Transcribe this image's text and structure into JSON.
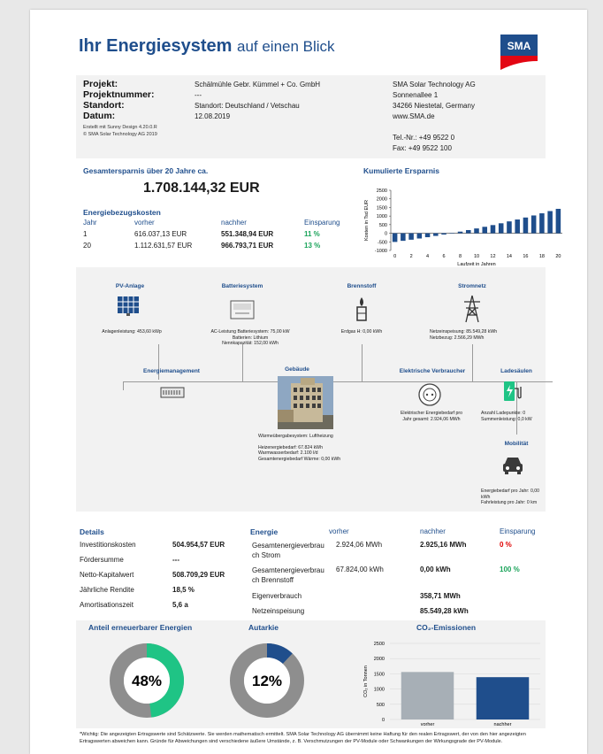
{
  "header": {
    "title_bold": "Ihr Energiesystem",
    "title_rest": "auf einen Blick",
    "logo": "SMA"
  },
  "project": {
    "labels": [
      "Projekt:",
      "Projektnummer:",
      "Standort:",
      "Datum:"
    ],
    "values": [
      "Schälmühle Gebr. Kümmel + Co. GmbH",
      "---",
      "Standort: Deutschland / Vetschau",
      "12.08.2019"
    ],
    "created_with": "Erstellt mit Sunny Design 4.20.0.R",
    "copyright": "© SMA Solar Technology AG 2019",
    "company_lines": [
      "SMA Solar Technology AG",
      "Sonnenallee 1",
      "34266 Niestetal, Germany",
      "www.SMA.de"
    ],
    "phone": "Tel.-Nr.: +49 9522 0",
    "fax": "Fax: +49 9522 100"
  },
  "savings": {
    "heading": "Gesamtersparnis über 20 Jahre ca.",
    "total": "1.708.144,32 EUR",
    "costs_heading": "Energiebezugskosten",
    "columns": [
      "Jahr",
      "vorher",
      "nachher",
      "Einsparung"
    ],
    "rows": [
      {
        "year": "1",
        "before": "616.037,13 EUR",
        "after": "551.348,94 EUR",
        "saving": "11 %"
      },
      {
        "year": "20",
        "before": "1.112.631,57 EUR",
        "after": "966.793,71 EUR",
        "saving": "13 %"
      }
    ]
  },
  "chart_data": [
    {
      "type": "bar",
      "title": "Kumulierte Ersparnis",
      "xlabel": "Laufzeit in Jahren",
      "ylabel": "Kosten in Tsd EUR",
      "ylim": [
        -1000,
        2500
      ],
      "yticks": [
        "2500",
        "2000",
        "1500",
        "1000",
        "500",
        "0",
        "-500",
        "-1000"
      ],
      "xticks": [
        "0",
        "2",
        "4",
        "6",
        "8",
        "10",
        "12",
        "14",
        "16",
        "18",
        "20"
      ],
      "categories": [
        0,
        1,
        2,
        3,
        4,
        5,
        6,
        7,
        8,
        9,
        10,
        11,
        12,
        13,
        14,
        15,
        16,
        17,
        18,
        19,
        20
      ],
      "values": [
        -505,
        -440,
        -375,
        -305,
        -230,
        -155,
        -75,
        10,
        95,
        185,
        280,
        375,
        475,
        580,
        690,
        800,
        915,
        1035,
        1160,
        1290,
        1420
      ],
      "color": "#1f4e8c"
    },
    {
      "type": "pie",
      "title": "Anteil erneuerbarer Energien",
      "value_percent": 48,
      "label": "48%",
      "color": "#1fc485"
    },
    {
      "type": "pie",
      "title": "Autarkie",
      "value_percent": 12,
      "label": "12%",
      "color": "#1f4e8c"
    },
    {
      "type": "bar",
      "title": "CO₂-Emissionen",
      "ylabel": "CO₂ in Tonnen",
      "ylim": [
        0,
        2500
      ],
      "yticks": [
        "2500",
        "2000",
        "1500",
        "1000",
        "500",
        "0"
      ],
      "categories": [
        "vorher",
        "nachher"
      ],
      "values": [
        1560,
        1390
      ],
      "colors": [
        "#a7afb6",
        "#1f4e8c"
      ]
    }
  ],
  "diagram": {
    "pv": {
      "title": "PV-Anlage",
      "text": "Anlagenleistung: 453,60 kWp"
    },
    "battery": {
      "title": "Batteriesystem",
      "lines": [
        "AC-Leistung Batteriesystem: 75,00 kW",
        "Batterien: Lithium",
        "Nennkapazität: 152,00 kWh"
      ]
    },
    "fuel": {
      "title": "Brennstoff",
      "text": "Erdgas H: 0,00 kWh"
    },
    "grid": {
      "title": "Stromnetz",
      "lines": [
        "Netzeinspeisung: 85.549,28 kWh",
        "Netzbezug: 2.566,29 MWh"
      ]
    },
    "mgmt": {
      "title": "Energiemanagement"
    },
    "building": {
      "title": "Gebäude",
      "lines": [
        "Wärmeübergabesystem: Luftheizung",
        "",
        "Heizenergiebedarf: 67.824 kWh",
        "Warmwasserbedarf: 2.100 l/d",
        "Gesamtenergiebedarf Wärme: 0,00 kWh"
      ]
    },
    "consumer": {
      "title": "Elektrische Verbraucher",
      "lines": [
        "Elektrischer Energiebedarf pro",
        "Jahr gesamt: 2.924,06 MWh"
      ]
    },
    "charging": {
      "title": "Ladesäulen",
      "lines": [
        "Anzahl Ladepunkte: 0",
        "Summenleistung: 0,0 kW"
      ]
    },
    "mobility": {
      "title": "Mobilität",
      "lines": [
        "Energiebedarf pro Jahr: 0,00",
        "kWh",
        "Fahrleistung pro Jahr: 0 km"
      ]
    }
  },
  "details": {
    "heading": "Details",
    "rows": [
      {
        "label": "Investitionskosten",
        "value": "504.954,57 EUR"
      },
      {
        "label": "Fördersumme",
        "value": "---"
      },
      {
        "label": "Netto-Kapitalwert",
        "value": "508.709,29 EUR"
      },
      {
        "label": "Jährliche Rendite",
        "value": "18,5 %"
      },
      {
        "label": "Amortisationszeit",
        "value": "5,6 a"
      }
    ]
  },
  "energy": {
    "heading": "Energie",
    "columns": [
      "vorher",
      "nachher",
      "Einsparung"
    ],
    "rows": [
      {
        "label1": "Gesamtenergieverbrau",
        "label2": "ch Strom",
        "before": "2.924,06 MWh",
        "after": "2.925,16 MWh",
        "saving": "0 %"
      },
      {
        "label1": "Gesamtenergieverbrau",
        "label2": "ch Brennstoff",
        "before": "67.824,00 kWh",
        "after": "0,00 kWh",
        "saving": "100 %"
      },
      {
        "label1": "Eigenverbrauch",
        "label2": "",
        "before": "",
        "after": "358,71 MWh",
        "saving": ""
      },
      {
        "label1": "Netzeinspeisung",
        "label2": "",
        "before": "",
        "after": "85.549,28 kWh",
        "saving": ""
      }
    ]
  },
  "footnote": "*Wichtig: Die angezeigten Ertragswerte sind Schätzwerte. Sie werden mathematisch ermittelt. SMA Solar Technology AG übernimmt keine Haftung für den realen Ertragswert, der von den hier angezeigten Ertragswerten abweichen kann. Gründe für Abweichungen sind verschiedene äußere Umstände, z. B. Verschmutzungen der PV-Module oder Schwankungen der Wirkungsgrade der PV-Module."
}
